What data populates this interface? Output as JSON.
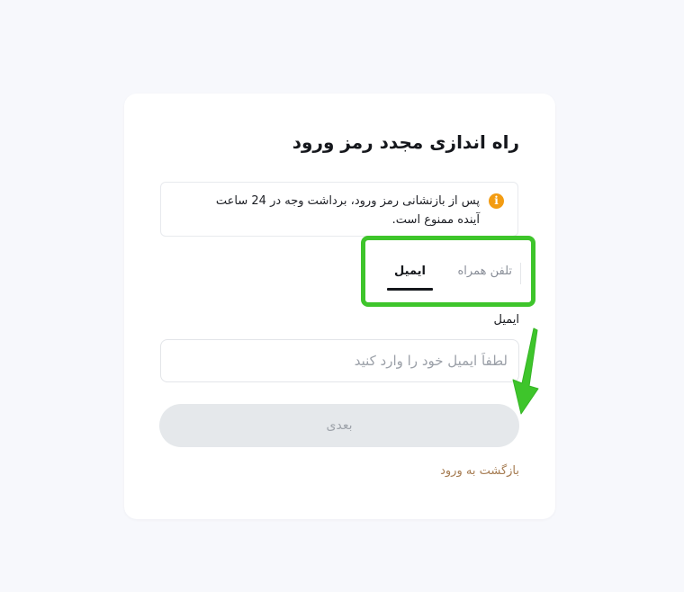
{
  "title": "راه اندازی مجدد رمز ورود",
  "notice": {
    "icon": "info-icon",
    "icon_glyph": "i",
    "text": "پس از بازنشانی رمز ورود، برداشت وجه در 24 ساعت آینده ممنوع است.",
    "icon_color": "#f39c12"
  },
  "tabs": [
    {
      "label": "تلفن همراه",
      "active": false
    },
    {
      "label": "ایمیل",
      "active": true
    }
  ],
  "email": {
    "label": "ایمیل",
    "placeholder": "لطفاً ایمیل خود را وارد کنید",
    "value": ""
  },
  "next_button": {
    "label": "بعدی",
    "disabled": true
  },
  "back_link": "بازگشت به ورود",
  "colors": {
    "highlight": "#3ec52b",
    "link": "#a67c52",
    "button_bg": "#e5e8eb"
  }
}
